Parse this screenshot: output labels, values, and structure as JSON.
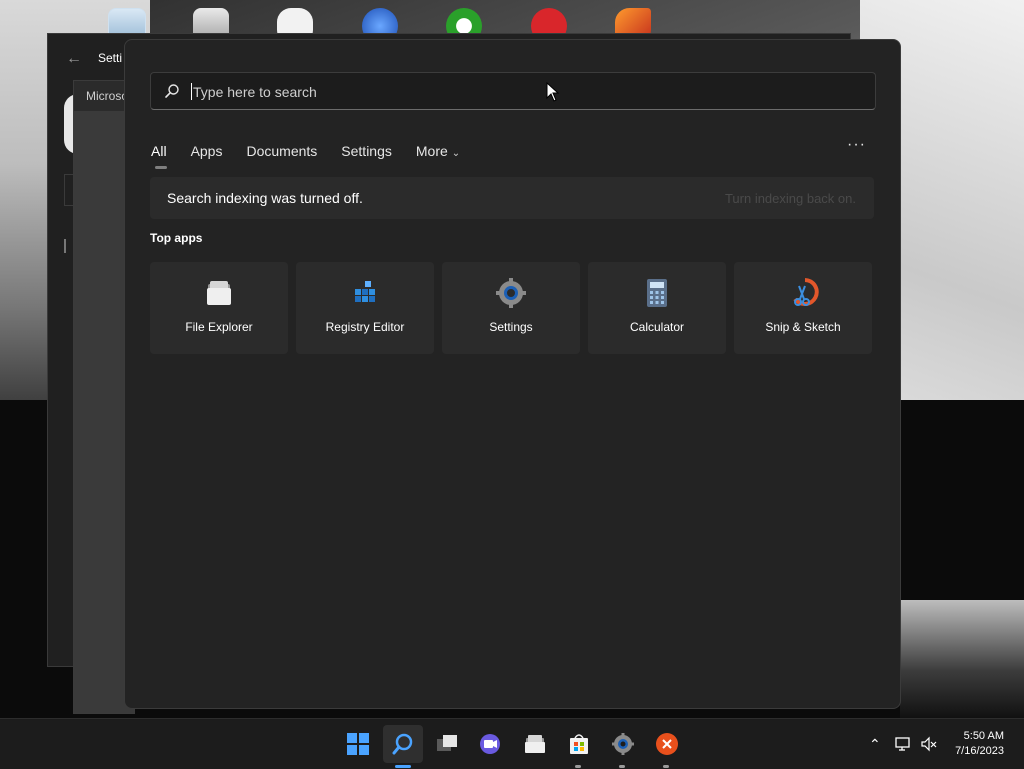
{
  "desktop": {
    "icons": [
      "recycle-bin-icon",
      "folder-icon",
      "gamepad-icon",
      "blue-app-icon",
      "xbox-icon",
      "youtube-icon",
      "phoenix-icon"
    ]
  },
  "settings_window": {
    "title": "Setti",
    "panel_label": "Microso"
  },
  "search": {
    "placeholder": "Type here to search",
    "value": "",
    "tabs": [
      {
        "label": "All"
      },
      {
        "label": "Apps"
      },
      {
        "label": "Documents"
      },
      {
        "label": "Settings"
      },
      {
        "label": "More"
      }
    ],
    "more_options": "···"
  },
  "notice": {
    "text": "Search indexing was turned off.",
    "link": "Turn indexing back on."
  },
  "top_apps": {
    "title": "Top apps",
    "items": [
      {
        "label": "File Explorer",
        "icon": "file-explorer-icon"
      },
      {
        "label": "Registry Editor",
        "icon": "registry-editor-icon"
      },
      {
        "label": "Settings",
        "icon": "settings-gear-icon"
      },
      {
        "label": "Calculator",
        "icon": "calculator-icon"
      },
      {
        "label": "Snip & Sketch",
        "icon": "snip-sketch-icon"
      }
    ]
  },
  "taskbar": {
    "buttons": [
      "start-icon",
      "search-icon",
      "task-view-icon",
      "chat-icon",
      "file-explorer-icon",
      "store-icon",
      "settings-gear-icon",
      "close-app-icon"
    ],
    "time": "5:50 AM",
    "date": "7/16/2023"
  },
  "colors": {
    "flyout_bg": "#232323",
    "tile_bg": "#2b2b2b",
    "taskbar_bg": "#1c1c1c",
    "accent": "#4aa3ff"
  }
}
